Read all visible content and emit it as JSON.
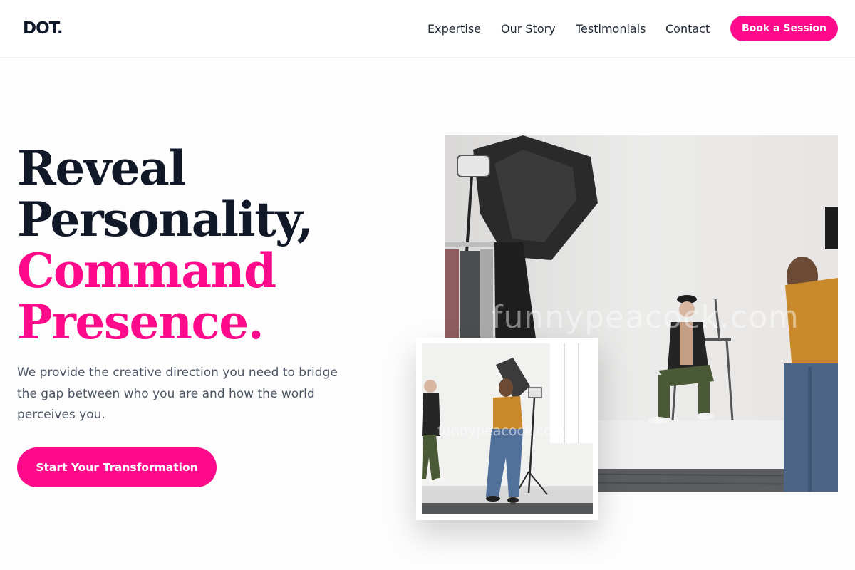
{
  "brand": {
    "logo": "DOT."
  },
  "nav": {
    "items": [
      "Expertise",
      "Our Story",
      "Testimonials",
      "Contact"
    ],
    "book_label": "Book a Session"
  },
  "hero": {
    "title_lines": [
      "Reveal",
      "Personality,",
      "Command",
      "Presence."
    ],
    "description": "We provide the creative direction you need to bridge the gap between who you are and how the world perceives you.",
    "cta_label": "Start Your Transformation"
  },
  "images": {
    "main_alt": "photographer shooting a seated model in a white studio",
    "small_alt": "photographer adjusting a softbox in a white studio",
    "watermark": "funnypeacock.com"
  },
  "colors": {
    "accent": "#ff0a8a",
    "heading": "#111827",
    "body_text": "#4b5563"
  }
}
